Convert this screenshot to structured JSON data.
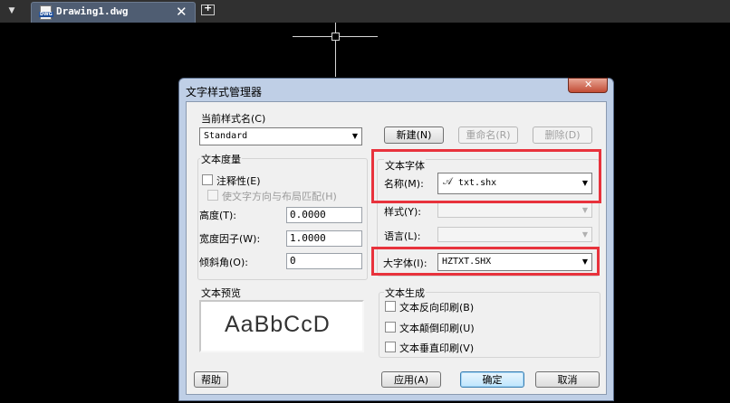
{
  "tabbar": {
    "menu_glyph": "▼",
    "tab_label": "Drawing1.dwg",
    "close_glyph": "✕"
  },
  "dialog": {
    "title": "文字样式管理器",
    "close_glyph": "✕",
    "current_style_label": "当前样式名(C)",
    "current_style_value": "Standard",
    "buttons": {
      "new": "新建(N)",
      "rename": "重命名(R)",
      "delete": "删除(D)",
      "help": "帮助",
      "apply": "应用(A)",
      "ok": "确定",
      "cancel": "取消"
    },
    "metrics": {
      "group_title": "文本度量",
      "annotative_label": "注释性(E)",
      "match_orientation_label": "使文字方向与布局匹配(H)",
      "height_label": "高度(T):",
      "height_value": "0.0000",
      "width_factor_label": "宽度因子(W):",
      "width_factor_value": "1.0000",
      "oblique_label": "倾斜角(O):",
      "oblique_value": "0"
    },
    "font": {
      "group_title": "文本字体",
      "name_label": "名称(M):",
      "name_value": "txt.shx",
      "style_label": "样式(Y):",
      "style_value": "",
      "language_label": "语言(L):",
      "language_value": "",
      "bigfont_label": "大字体(I):",
      "bigfont_value": "HZTXT.SHX"
    },
    "preview": {
      "group_title": "文本预览",
      "sample_text": "AaBbCcD"
    },
    "effects": {
      "group_title": "文本生成",
      "backwards_label": "文本反向印刷(B)",
      "upside_down_label": "文本颠倒印刷(U)",
      "vertical_label": "文本垂直印刷(V)"
    }
  },
  "colors": {
    "highlight": "#e8323c",
    "dialog_frame": "#bfcfe6",
    "canvas": "#000000"
  }
}
